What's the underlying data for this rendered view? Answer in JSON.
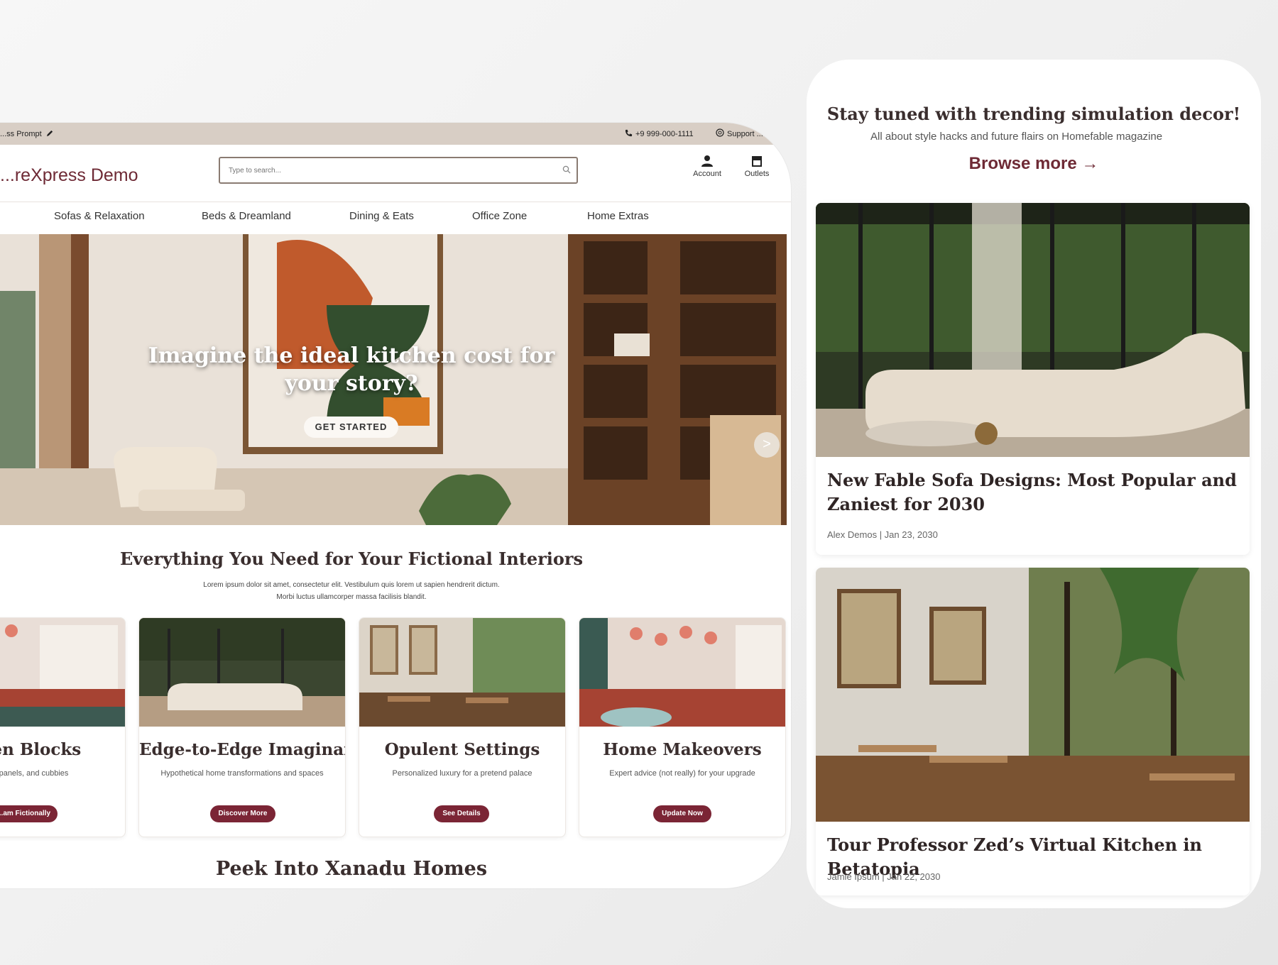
{
  "desktop": {
    "topbar": {
      "left_text": "...ss Prompt",
      "phone": "+9 999-000-1111",
      "support": "Support ..."
    },
    "header": {
      "logo": "...reXpress Demo",
      "search_placeholder": "Type to search...",
      "account_label": "Account",
      "outlets_label": "Outlets"
    },
    "nav": [
      "Sofas & Relaxation",
      "Beds & Dreamland",
      "Dining & Eats",
      "Office Zone",
      "Home Extras"
    ],
    "hero": {
      "title": "Imagine the ideal kitchen cost for your story?",
      "button": "GET STARTED",
      "next_arrow": ">"
    },
    "section": {
      "title": "Everything You Need for Your Fictional Interiors",
      "description": "Lorem ipsum dolor sit amet, consectetur elit. Vestibulum quis lorem ut sapien hendrerit dictum. Morbi luctus ullamcorper massa facilisis blandit."
    },
    "cards": [
      {
        "title": "...hen Blocks",
        "desc": "...helf, panels, and cubbies",
        "button": "...am Fictionally"
      },
      {
        "title": "Edge-to-Edge Imaginary",
        "desc": "Hypothetical home transformations and spaces",
        "button": "Discover More"
      },
      {
        "title": "Opulent Settings",
        "desc": "Personalized luxury for a pretend palace",
        "button": "See Details"
      },
      {
        "title": "Home Makeovers",
        "desc": "Expert advice (not really) for your upgrade",
        "button": "Update Now"
      }
    ],
    "section2_title": "Peek Into Xanadu Homes"
  },
  "mobile": {
    "title": "Stay tuned with trending simulation decor!",
    "subtitle": "All about style hacks and future flairs on Homefable magazine",
    "browse": "Browse more →",
    "posts": [
      {
        "title": "New Fable Sofa Designs: Most Popular and Zaniest for 2030",
        "meta": "Alex Demos | Jan 23, 2030"
      },
      {
        "title": "Tour Professor Zed’s Virtual Kitchen in Betatopia",
        "meta": "Jamie Ipsum | Jan 22, 2030"
      }
    ]
  },
  "colors": {
    "brand": "#7b2535",
    "topbar": "#d8cec5",
    "heading": "#3a2e2e"
  },
  "icons": [
    "pencil-icon",
    "phone-icon",
    "support-icon",
    "search-icon",
    "account-icon",
    "outlets-icon",
    "next-arrow-icon"
  ]
}
